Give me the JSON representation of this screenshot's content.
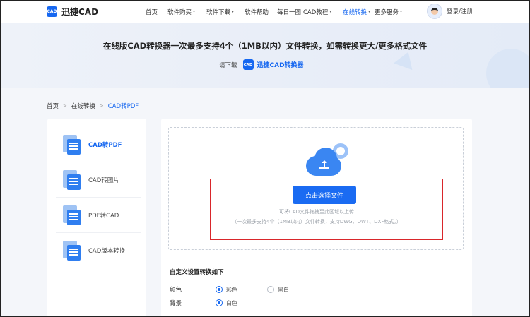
{
  "header": {
    "logo_mark": "CAD",
    "logo_text": "迅捷CAD",
    "nav": [
      {
        "label": "首页",
        "caret": false,
        "active": false
      },
      {
        "label": "软件购买",
        "caret": true,
        "active": false
      },
      {
        "label": "软件下载",
        "caret": true,
        "active": false
      },
      {
        "label": "软件帮助",
        "caret": false,
        "active": false
      },
      {
        "label": "每日一图",
        "caret": false,
        "active": false
      },
      {
        "label": "CAD教程",
        "caret": true,
        "active": false
      },
      {
        "label": "在线转换",
        "caret": true,
        "active": true
      },
      {
        "label": "更多服务",
        "caret": true,
        "active": false
      }
    ],
    "user_text": "登录/注册"
  },
  "banner": {
    "title": "在线版CAD转换器一次最多支持4个（1MB以内）文件转换，如需转换更大/更多格式文件",
    "download_prompt": "请下载",
    "download_icon": "CAD",
    "download_link": "迅捷CAD转换器"
  },
  "breadcrumb": {
    "home": "首页",
    "section": "在线转换",
    "current": "CAD转PDF"
  },
  "sidebar": {
    "items": [
      {
        "label": "CAD转PDF",
        "active": true
      },
      {
        "label": "CAD转图片",
        "active": false
      },
      {
        "label": "PDF转CAD",
        "active": false
      },
      {
        "label": "CAD版本转换",
        "active": false
      }
    ]
  },
  "upload": {
    "button_label": "点击选择文件",
    "hint_line1": "可将CAD文件拖拽至此区域以上传",
    "hint_line2": "（一次最多支持4个（1MB以内）文件转换，支持DWG、DWT、DXF格式。）"
  },
  "settings": {
    "title": "自定义设置转换如下",
    "color": {
      "label": "颜色",
      "options": [
        "彩色",
        "黑白"
      ],
      "selected": "彩色"
    },
    "background": {
      "label": "背景",
      "options": [
        "白色"
      ],
      "selected": "白色"
    }
  },
  "colors": {
    "accent": "#1667f0",
    "highlight_box": "#d9272b"
  }
}
